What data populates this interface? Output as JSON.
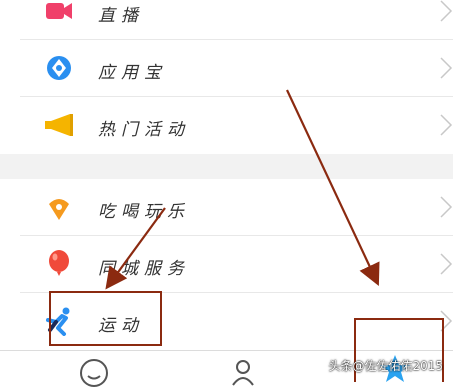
{
  "menu": {
    "items": [
      {
        "label": "直播",
        "icon": "video-camera-icon",
        "color": "#f0406a"
      },
      {
        "label": "应用宝",
        "icon": "app-store-icon",
        "color": "#2a8ff0"
      },
      {
        "label": "热门活动",
        "icon": "megaphone-icon",
        "color": "#f5b400"
      },
      {
        "label": "吃喝玩乐",
        "icon": "ice-cream-icon",
        "color": "#f59a1e"
      },
      {
        "label": "同城服务",
        "icon": "balloon-icon",
        "color": "#f04a3a"
      },
      {
        "label": "运动",
        "icon": "runner-icon",
        "color": "#2a8ff0"
      }
    ]
  },
  "tabbar": {
    "items": [
      {
        "icon": "smile-icon"
      },
      {
        "icon": "contacts-icon"
      },
      {
        "icon": "star-icon",
        "color": "#2aa3f0"
      }
    ]
  },
  "annotation": {
    "color": "#8b2a10"
  },
  "watermark": "头条@佐佐佑佑2015"
}
